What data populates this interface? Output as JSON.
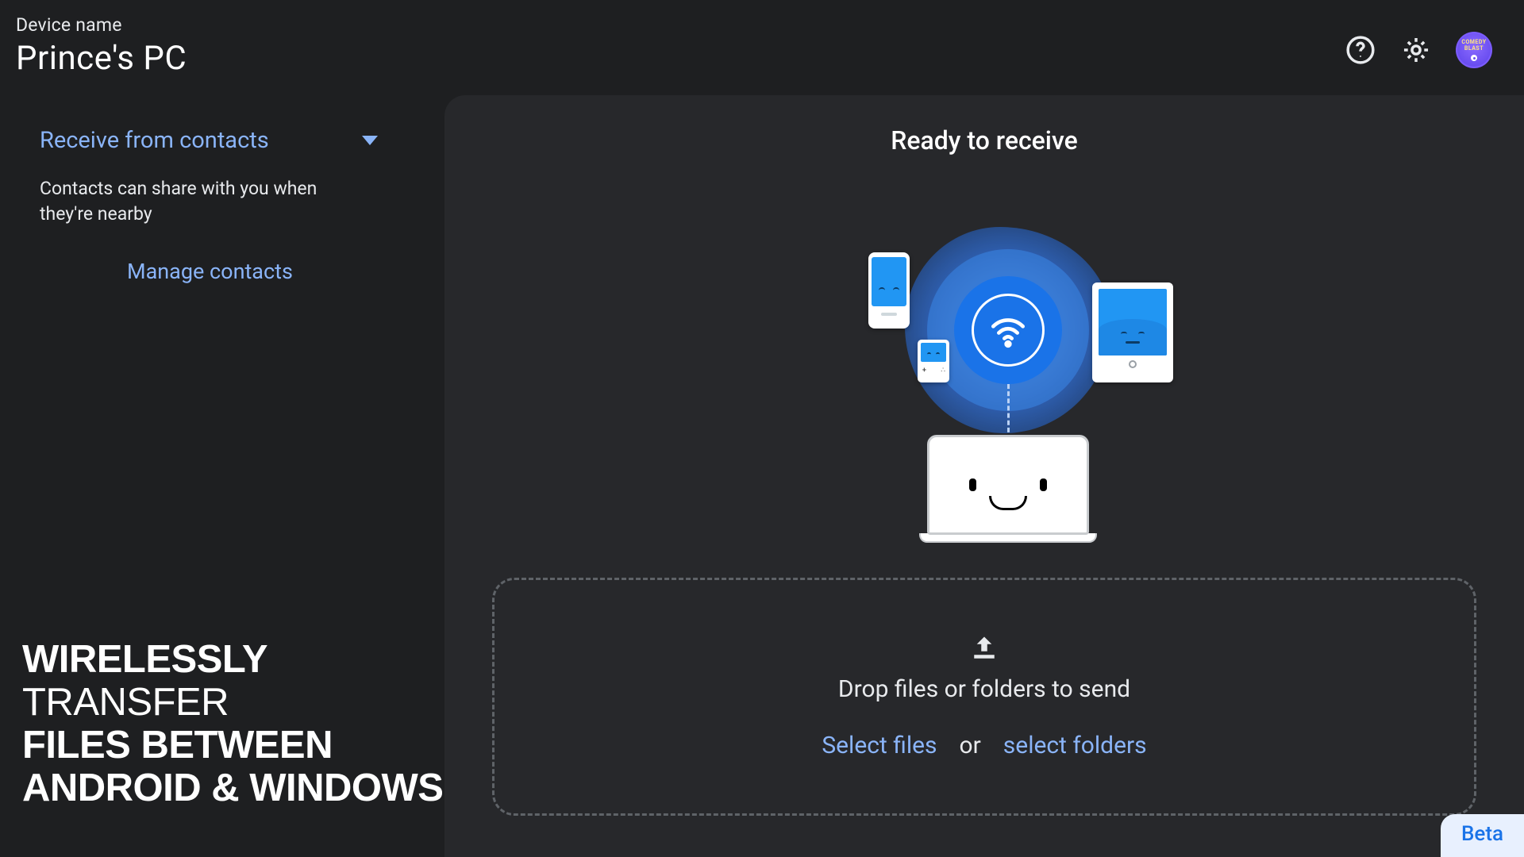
{
  "header": {
    "device_label": "Device name",
    "device_name": "Prince's PC",
    "avatar_text_top": "COMEDY",
    "avatar_text_bottom": "BLAST"
  },
  "sidebar": {
    "dropdown_label": "Receive from contacts",
    "dropdown_desc": "Contacts can share with you when they're nearby",
    "manage_link": "Manage contacts"
  },
  "promo": {
    "w1_bold": "WIRELESSLY",
    "w1_rest": " TRANSFER",
    "line2": "FILES BETWEEN",
    "line3": "ANDROID & WINDOWS"
  },
  "main": {
    "status_title": "Ready to receive",
    "drop_text": "Drop files or folders to send",
    "select_files": "Select files",
    "or": "or",
    "select_folders": "select folders",
    "beta_label": "Beta"
  },
  "colors": {
    "accent": "#8ab4f8",
    "bg": "#1e1f21",
    "panel": "#27282b",
    "avatar": "#7c5cff"
  }
}
